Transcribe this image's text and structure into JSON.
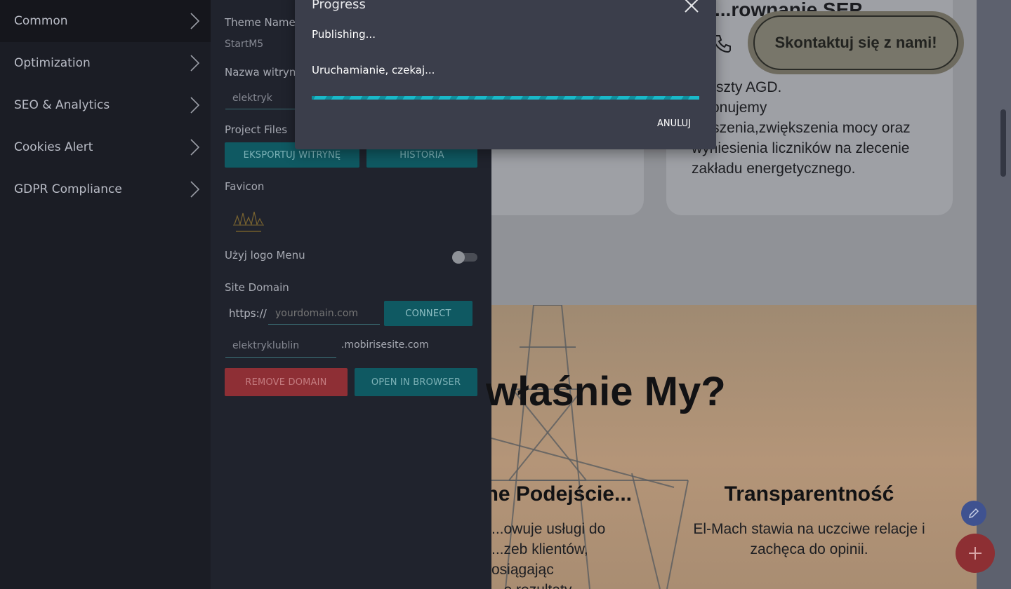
{
  "sidebar": {
    "items": [
      {
        "label": "Common"
      },
      {
        "label": "Optimization"
      },
      {
        "label": "SEO & Analytics"
      },
      {
        "label": "Cookies Alert"
      },
      {
        "label": "GDPR Compliance"
      }
    ]
  },
  "settings": {
    "theme_name_label": "Theme Name",
    "theme_name_value": "StartM5",
    "site_name_label": "Nazwa witryny",
    "site_name_value": "elektryk",
    "project_files_label": "Project Files",
    "export_button": "Eksportuj witrynę",
    "history_button": "Historia",
    "favicon_label": "Favicon",
    "use_logo_menu_label": "Użyj logo Menu",
    "use_logo_menu_on": false,
    "site_domain_label": "Site Domain",
    "protocol": "https://",
    "domain_placeholder": "yourdomain.com",
    "connect_button": "Connect",
    "subdomain_value": "elektryklublin",
    "subdomain_suffix": ".mobirisesite.com",
    "remove_domain_button": "Remove Domain",
    "open_browser_button": "Open in Browser"
  },
  "dialog": {
    "title": "Progress",
    "status": "Publishing...",
    "message": "Uruchamianie, czekaj...",
    "cancel_button": "Anuluj"
  },
  "preview": {
    "heading_partial": "...rownanie SEP",
    "contact_button": "Skontaktuj się z nami!",
    "card_lines": [
      "z reszty AGD.",
      "...konujemy",
      "...oszenia,zwiększenia mocy oraz",
      "wyniesienia liczników na zlecenie",
      "zakładu energetycznego."
    ],
    "hero_title": "właśnie My?",
    "col1_title": "...ne Podejście",
    "col1_lines": [
      "...owuje usługi do",
      "...zeb klientów, osiągając",
      "...e rezultaty."
    ],
    "col2_title": "Transparentność",
    "col2_lines": [
      "El-Mach stawia na uczciwe relacje i",
      "zachęca do opinii."
    ]
  }
}
